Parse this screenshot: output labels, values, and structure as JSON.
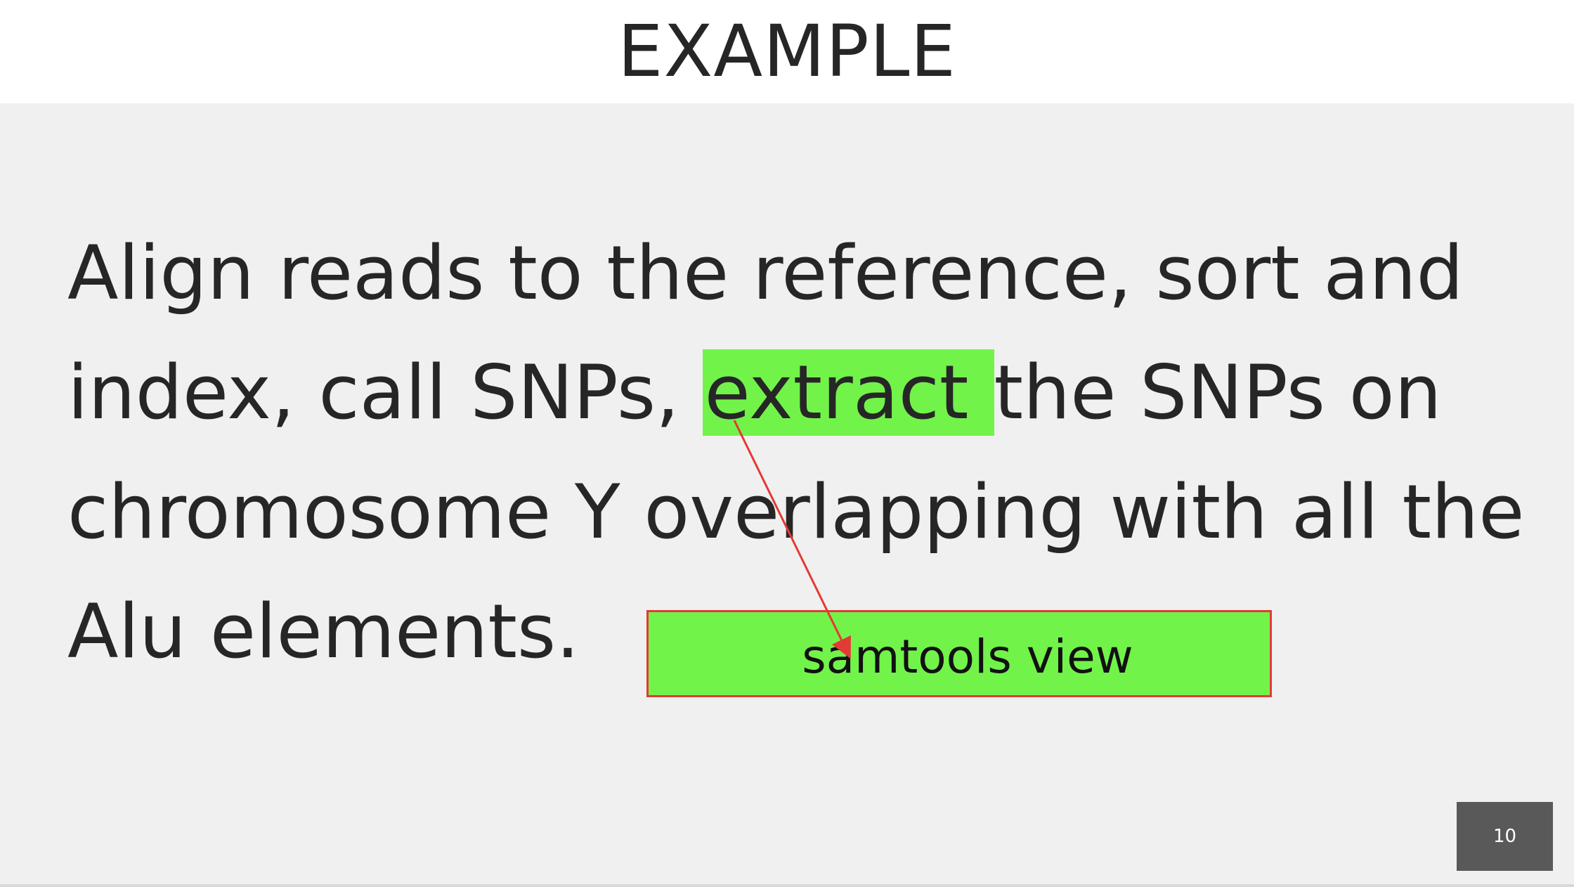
{
  "slide": {
    "title": "EXAMPLE",
    "body": {
      "line1": "Align reads to the reference, sort and",
      "line2_before": "index, call SNPs, ",
      "line2_highlight": "extract",
      "line2_after": "the SNPs on",
      "line3": "chromosome Y overlapping with all the",
      "line4": "Alu elements."
    },
    "callout": {
      "label": "samtools view"
    },
    "page_number": "10"
  },
  "colors": {
    "background": "#f0f0f0",
    "title_bar": "#ffffff",
    "text": "#262626",
    "highlight": "#72f34a",
    "callout_border": "#e53935",
    "arrow": "#e53935",
    "page_number_box": "#595959"
  }
}
